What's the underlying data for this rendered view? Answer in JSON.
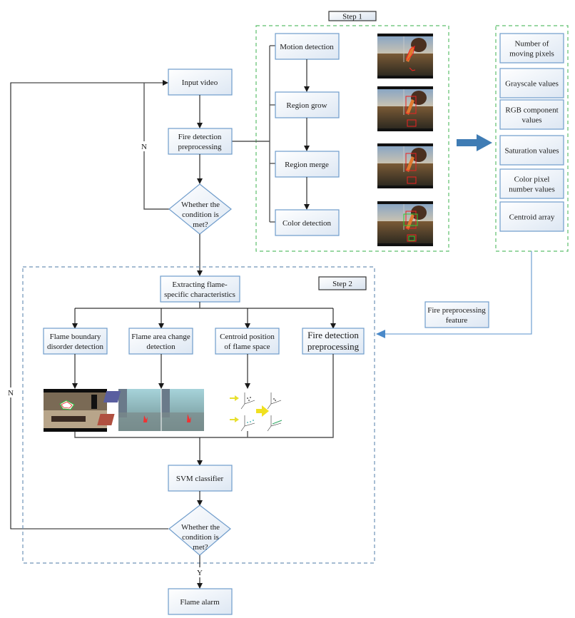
{
  "step1_label": "Step 1",
  "step2_label": "Step 2",
  "main_flow": {
    "input_video": "Input video",
    "fire_preprocessing": [
      "Fire detection",
      "preprocessing"
    ],
    "decision1": [
      "Whether the",
      "condition is",
      "met?"
    ],
    "decision1_no": "N",
    "extract": [
      "Extracting flame-",
      "specific characteristics"
    ],
    "svm": "SVM classifier",
    "decision2": [
      "Whether the",
      "condition is",
      "met?"
    ],
    "decision2_no": "N",
    "decision2_yes": "Y",
    "alarm": "Flame alarm"
  },
  "step1_methods": [
    "Motion detection",
    "Region grow",
    "Region merge",
    "Color detection"
  ],
  "step1_images": [
    "motion-detection-frame",
    "region-grow-frame",
    "region-merge-frame",
    "color-detection-frame"
  ],
  "features": [
    [
      "Number of",
      "moving pixels"
    ],
    [
      "Grayscale values"
    ],
    [
      "RGB component",
      "values"
    ],
    [
      "Saturation values"
    ],
    [
      "Color pixel",
      "number values"
    ],
    [
      "Centroid array"
    ]
  ],
  "feature_link": [
    "Fire preprocessing",
    "feature"
  ],
  "step2_branches": [
    [
      "Flame boundary",
      "disorder detection"
    ],
    [
      "Flame area change",
      "detection"
    ],
    [
      "Centroid position",
      "of flame space"
    ],
    [
      "Fire detection",
      "preprocessing"
    ]
  ],
  "colors": {
    "box_border": "#6f9ccb",
    "step1_border": "#5cbf6c",
    "step2_border": "#6f93b8",
    "big_arrow": "#3f7cb4",
    "feature_link_line": "#7aa7d6"
  }
}
